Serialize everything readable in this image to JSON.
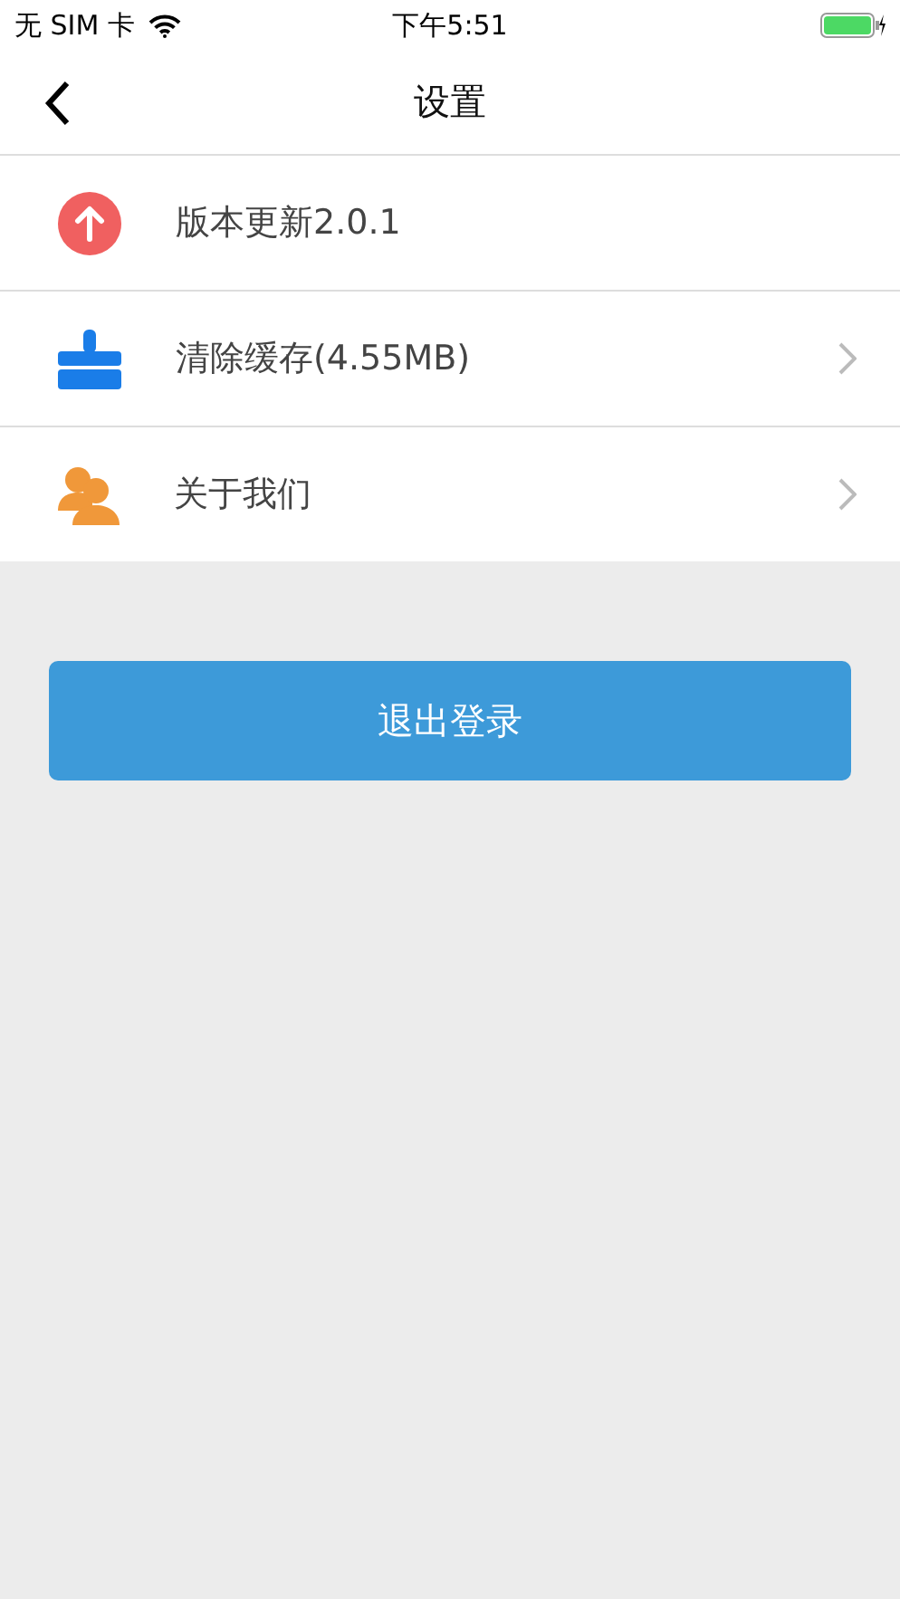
{
  "status_bar": {
    "carrier": "无 SIM 卡",
    "time": "下午5:51"
  },
  "nav": {
    "title": "设置"
  },
  "items": [
    {
      "kind": "update",
      "label": "版本更新2.0.1",
      "chevron": false
    },
    {
      "kind": "cache",
      "label": "清除缓存(4.55MB)",
      "chevron": true
    },
    {
      "kind": "about",
      "label": "关于我们",
      "chevron": true
    }
  ],
  "logout_button": "退出登录"
}
